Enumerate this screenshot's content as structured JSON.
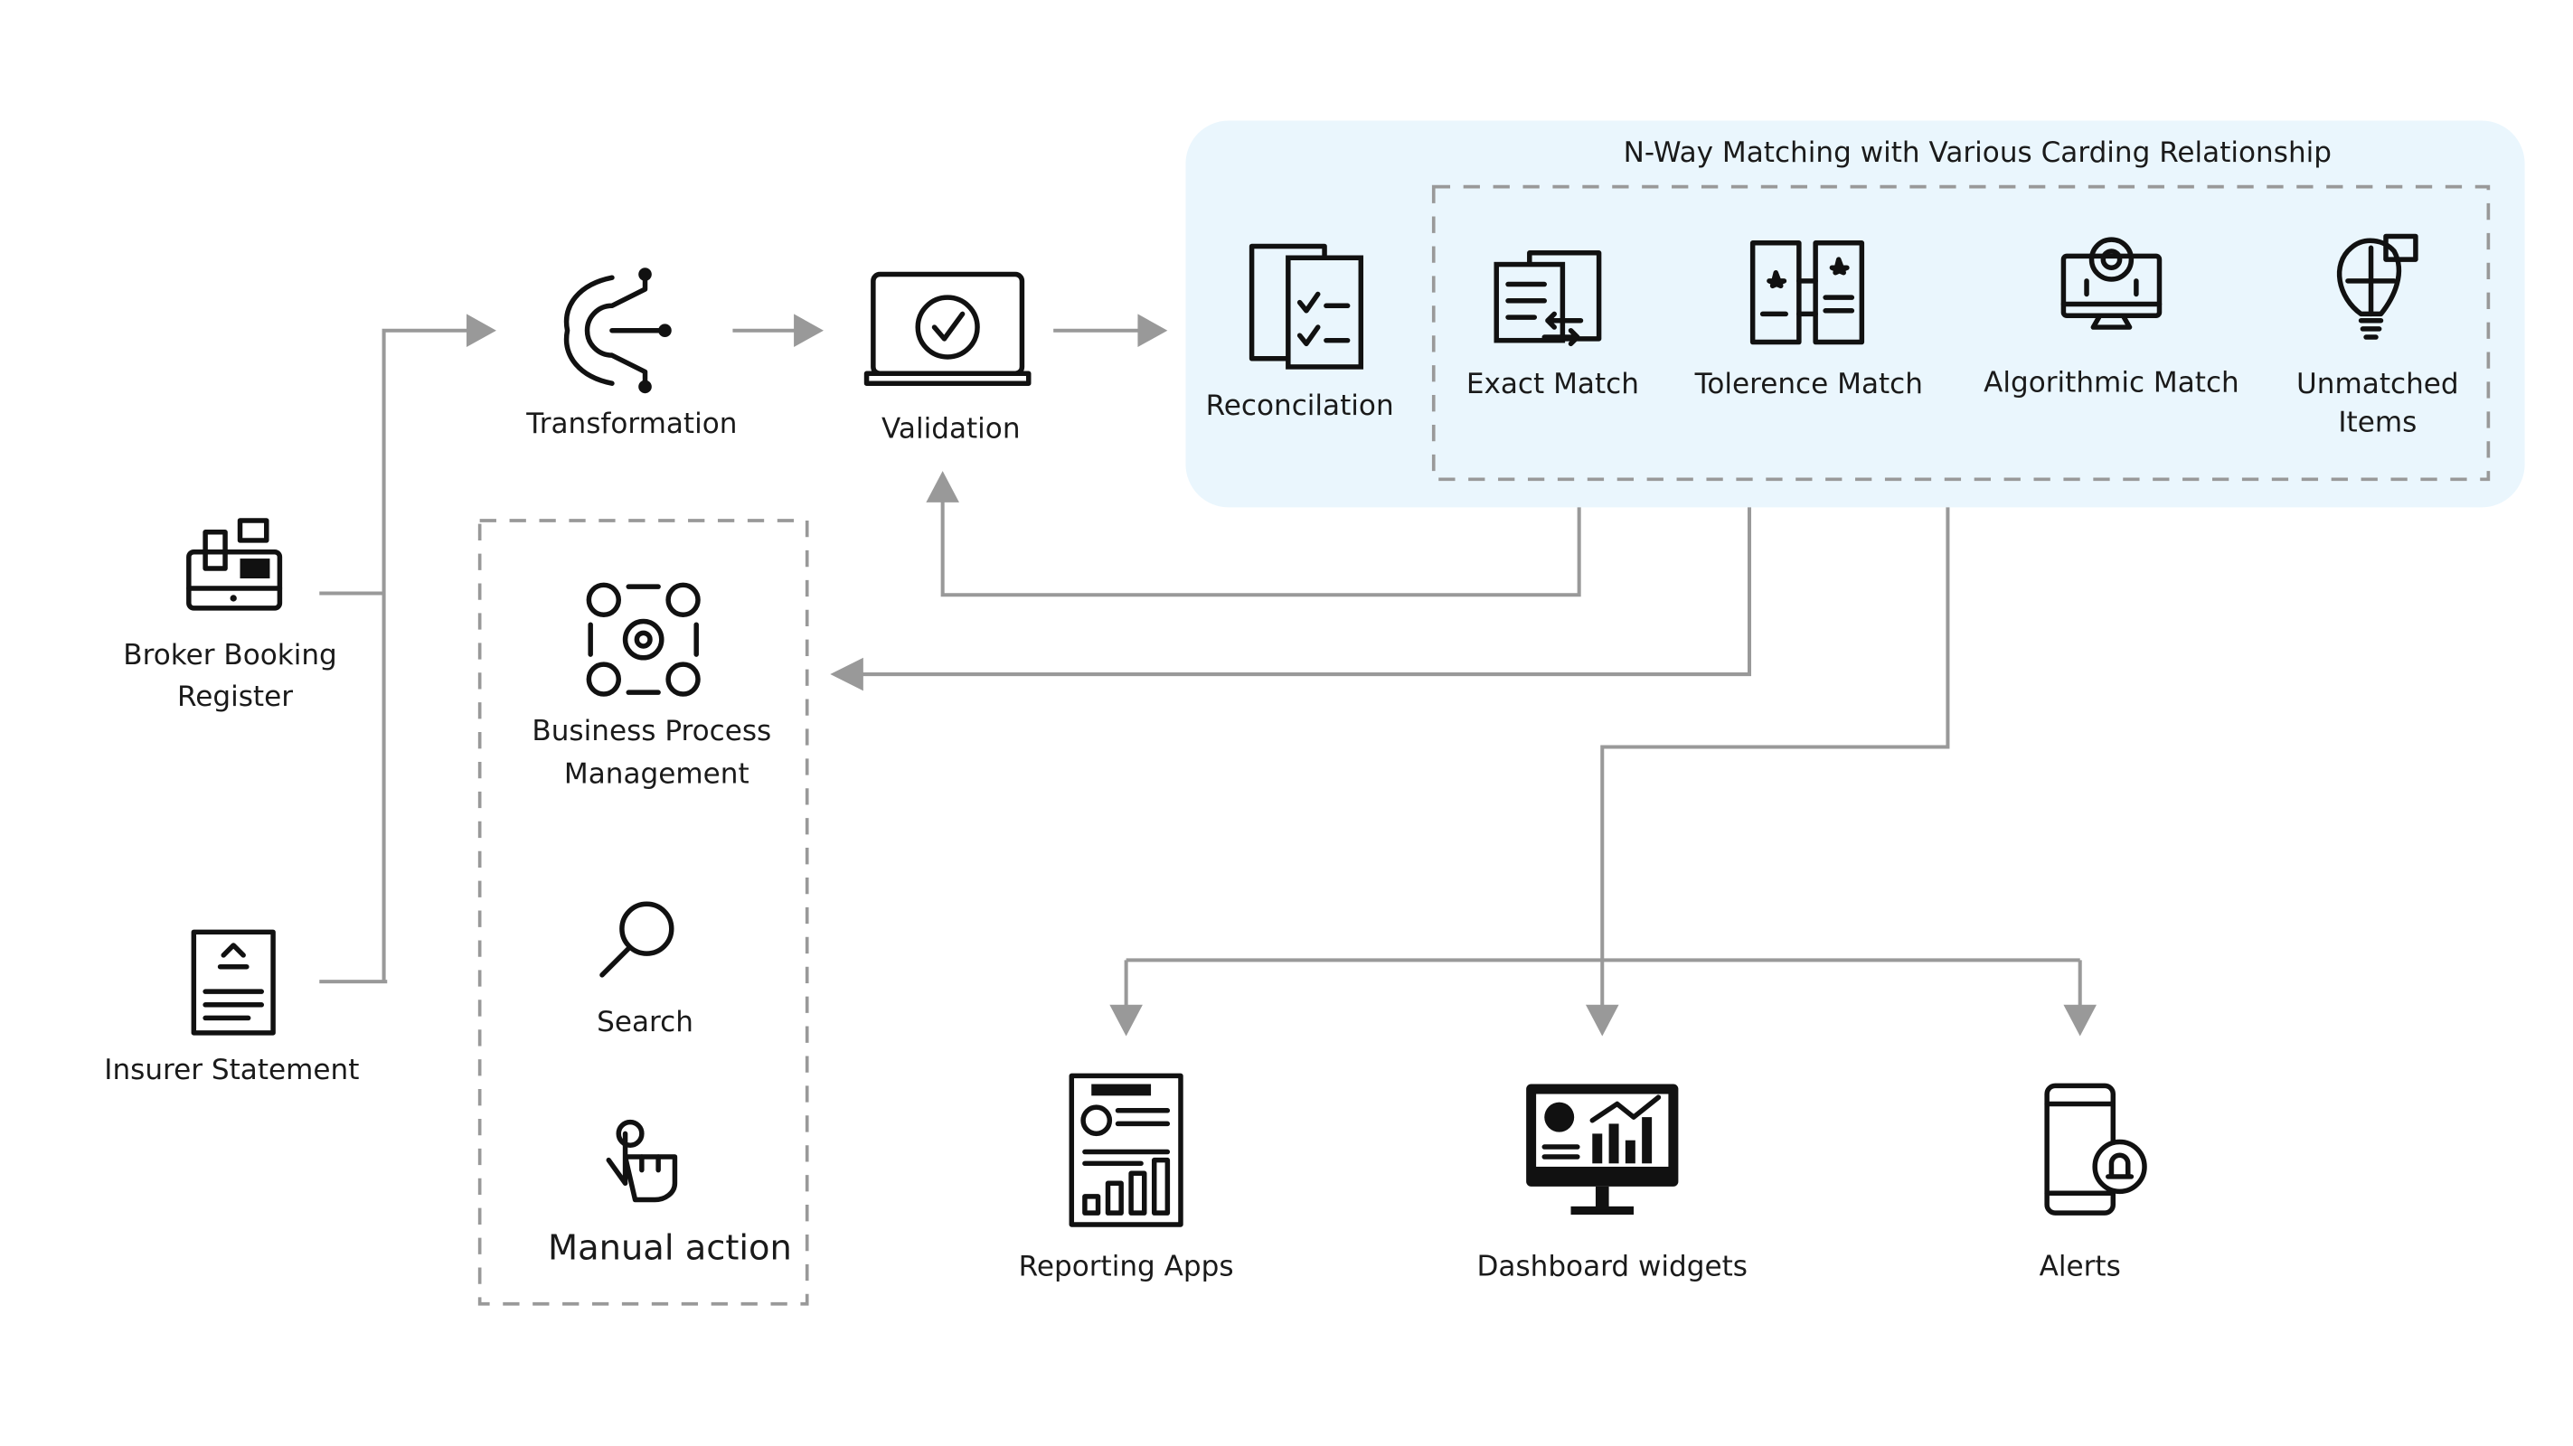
{
  "colors": {
    "panel_fill": "#eaf6fd",
    "connector": "#999999",
    "icon": "#111111"
  },
  "sources": [
    {
      "label_lines": [
        "Broker Booking",
        "Register"
      ],
      "icon": "cash-register-icon"
    },
    {
      "label_lines": [
        "Insurer Statement"
      ],
      "icon": "bank-statement-icon"
    }
  ],
  "pipeline": {
    "transformation": {
      "label": "Transformation",
      "icon": "gear-circuit-icon"
    },
    "validation": {
      "label": "Validation",
      "icon": "laptop-check-icon"
    }
  },
  "matching_panel": {
    "title": "N-Way Matching with Various Carding Relationship",
    "reconciliation": {
      "label": "Reconcilation",
      "icon": "checklist-documents-icon"
    },
    "items": [
      {
        "label_lines": [
          "Exact Match"
        ],
        "icon": "document-exchange-icon"
      },
      {
        "label_lines": [
          "Tolerence Match"
        ],
        "icon": "star-cards-icon"
      },
      {
        "label_lines": [
          "Algorithmic Match"
        ],
        "icon": "monitor-gear-icon"
      },
      {
        "label_lines": [
          "Unmatched",
          "Items"
        ],
        "icon": "puzzle-bulb-icon"
      }
    ]
  },
  "manual_group": {
    "items": [
      {
        "label_lines": [
          "Business Process",
          "Management"
        ],
        "icon": "process-cycle-icon"
      },
      {
        "label_lines": [
          "Search"
        ],
        "icon": "magnifier-icon"
      },
      {
        "label_lines": [
          "Manual action"
        ],
        "icon": "hand-pointer-icon"
      }
    ]
  },
  "outputs": [
    {
      "label": "Reporting Apps",
      "icon": "report-document-icon"
    },
    {
      "label": "Dashboard widgets",
      "icon": "monitor-chart-icon"
    },
    {
      "label": "Alerts",
      "icon": "phone-bell-icon"
    }
  ]
}
